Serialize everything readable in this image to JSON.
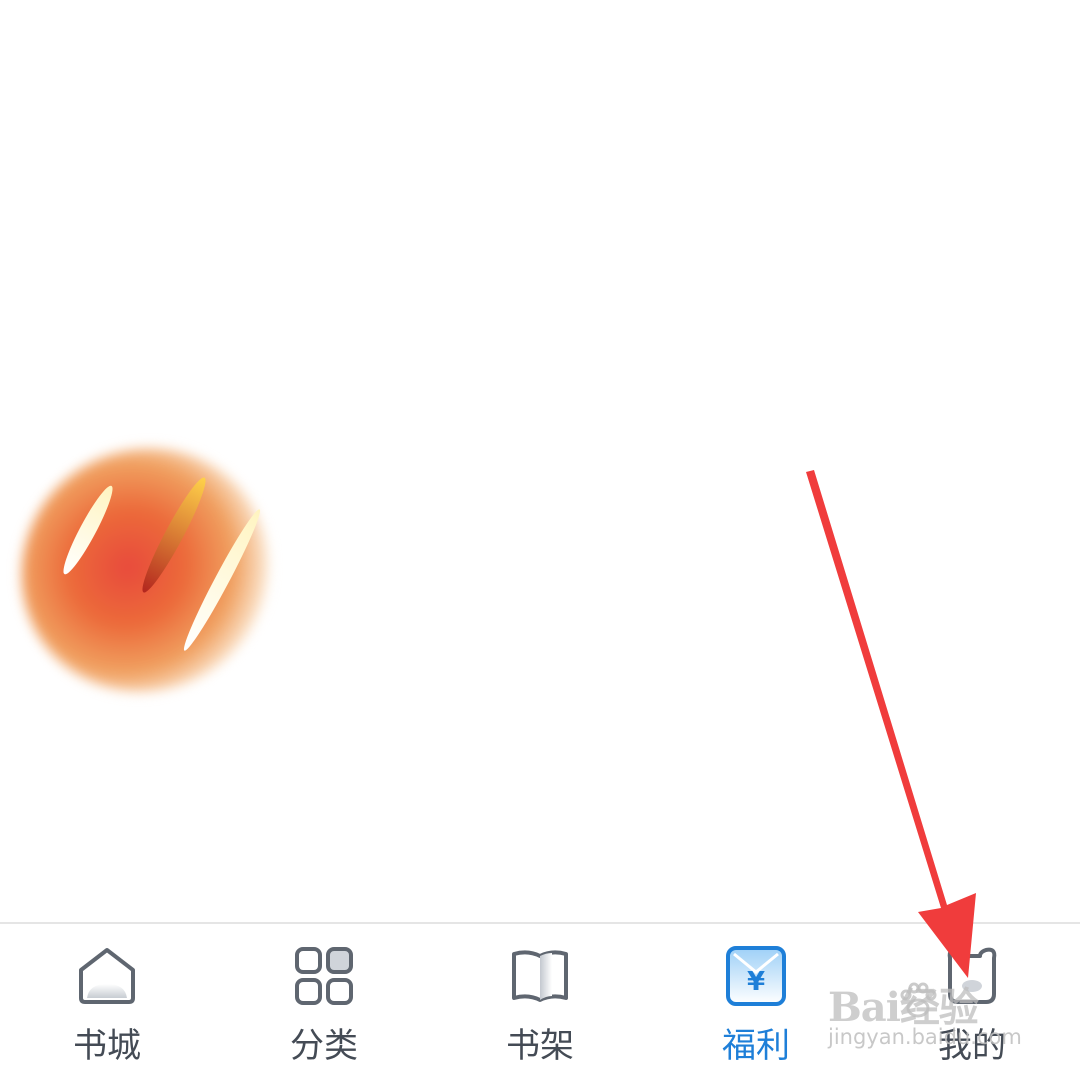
{
  "tabbar": {
    "tabs": [
      {
        "label": "书城",
        "icon": "home-icon",
        "active": false
      },
      {
        "label": "分类",
        "icon": "grid-icon",
        "active": false
      },
      {
        "label": "书架",
        "icon": "book-icon",
        "active": false
      },
      {
        "label": "福利",
        "icon": "yuan-icon",
        "active": true
      },
      {
        "label": "我的",
        "icon": "bear-icon",
        "active": false
      }
    ],
    "active_color": "#1e7fd8",
    "inactive_color": "#444b55"
  },
  "annotation": {
    "arrow_color": "#f03c3c"
  },
  "watermark": {
    "brand": "Bai经验",
    "sub": "jingyan.baidu.com"
  }
}
